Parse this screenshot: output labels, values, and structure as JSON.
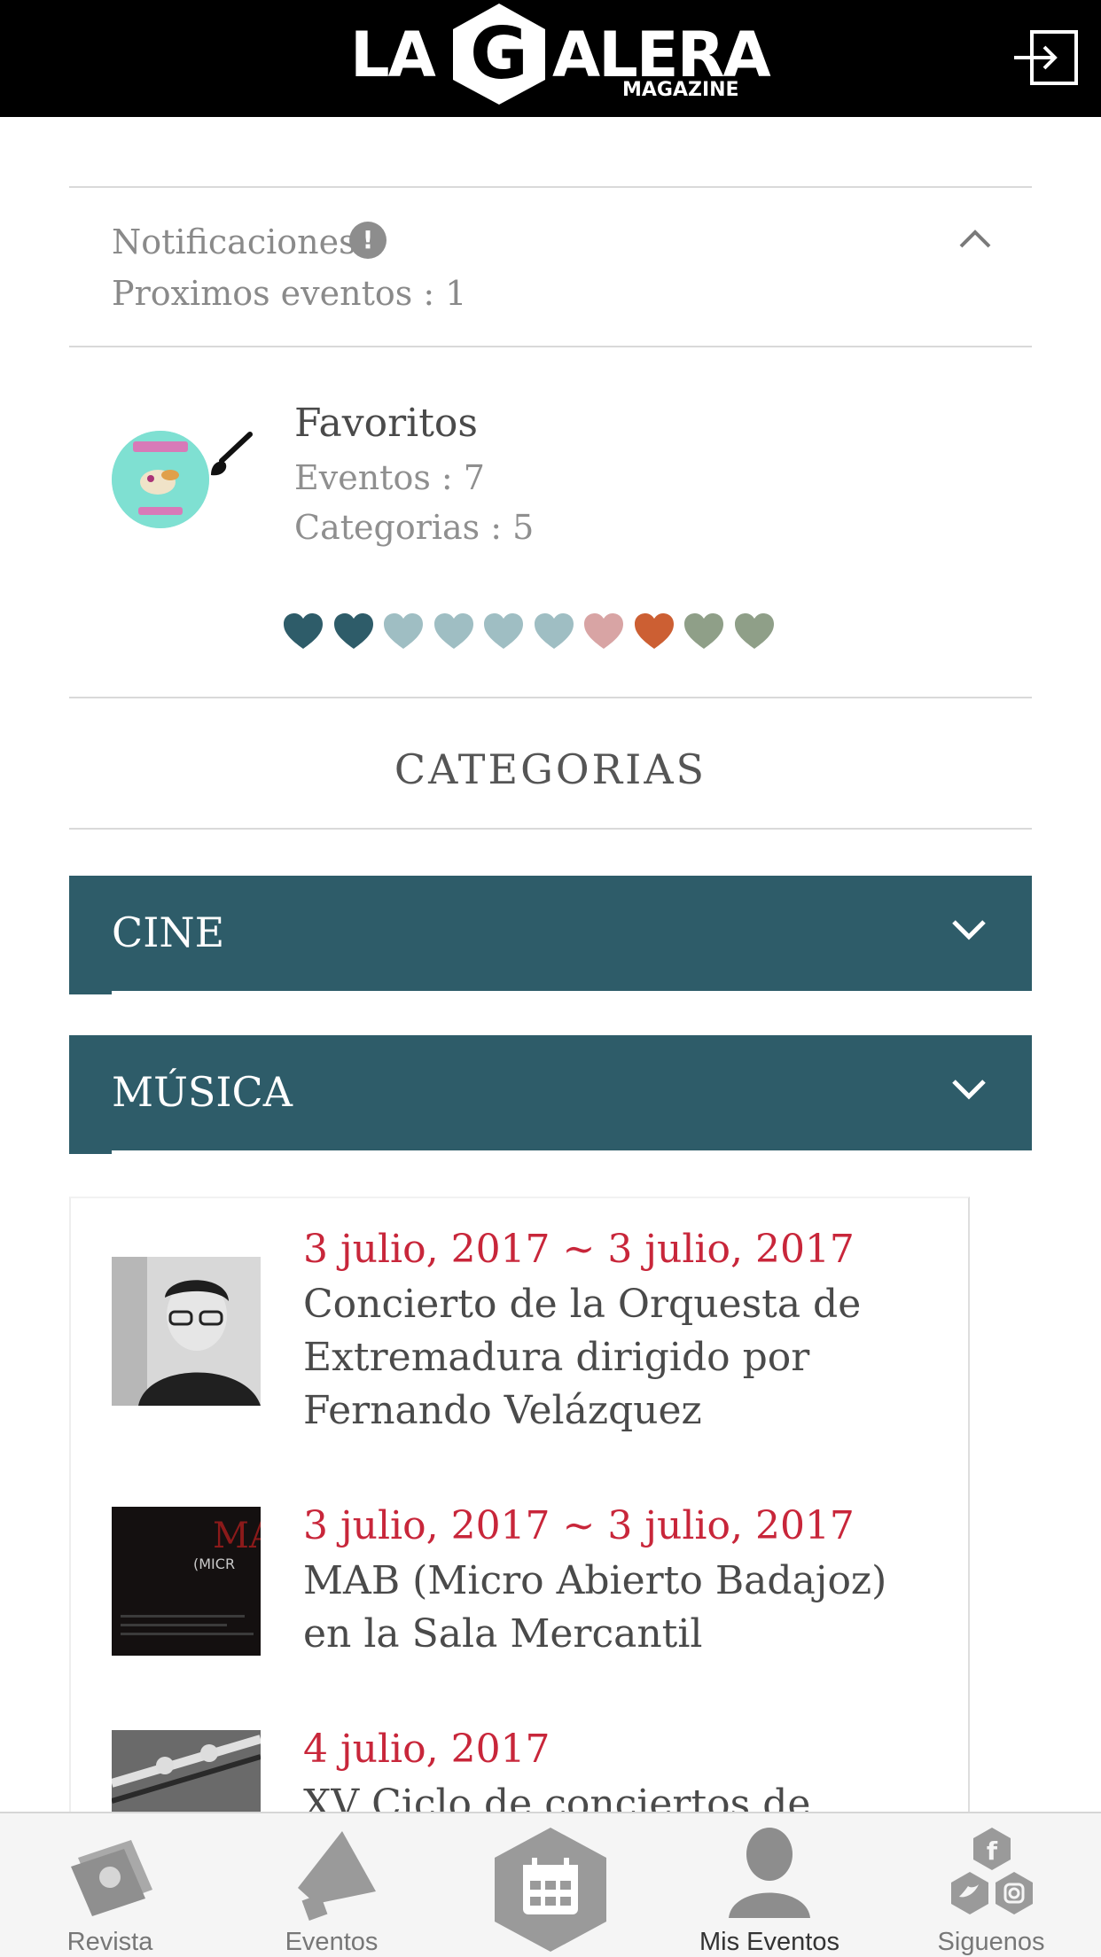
{
  "header": {
    "logo_left": "LA",
    "logo_right": "ALERA",
    "logo_letter": "G",
    "logo_sub": "MAGAZINE",
    "logout_icon": "logout-icon"
  },
  "notifications": {
    "title": "Notificaciones",
    "info_glyph": "!",
    "upcoming": "Proximos eventos : 1",
    "toggle_icon": "chevron-up-icon"
  },
  "favorites": {
    "title": "Favoritos",
    "events": "Eventos : 7",
    "categories": "Categorias : 5",
    "edit_icon": "brush-icon",
    "heart_colors": [
      "#2e5c69",
      "#2e5c69",
      "#9fbec3",
      "#9fbec3",
      "#9fbec3",
      "#9fbec3",
      "#d8a4a4",
      "#cc5f33",
      "#8f9f88",
      "#8f9f88"
    ]
  },
  "categories": {
    "heading": "CATEGORIAS",
    "bar_color": "#2e5c69",
    "items": [
      {
        "label": "CINE"
      },
      {
        "label": "MÚSICA"
      }
    ]
  },
  "events": [
    {
      "date": "3 julio, 2017 ~ 3 julio, 2017",
      "title": "Concierto de la Orquesta de Extremadura dirigido por Fernando Velázquez"
    },
    {
      "date": "3 julio, 2017 ~ 3 julio, 2017",
      "title": "MAB (Micro Abierto Badajoz) en la Sala Mercantil"
    },
    {
      "date": "4 julio, 2017",
      "title": "XV Ciclo de conciertos de"
    }
  ],
  "nav": {
    "items": [
      {
        "label": "Revista",
        "icon": "magazine-icon"
      },
      {
        "label": "Eventos",
        "icon": "megaphone-icon"
      },
      {
        "label": "",
        "icon": "calendar-icon"
      },
      {
        "label": "Mis Eventos",
        "icon": "user-icon"
      },
      {
        "label": "Siguenos",
        "icon": "social-icon"
      }
    ]
  }
}
